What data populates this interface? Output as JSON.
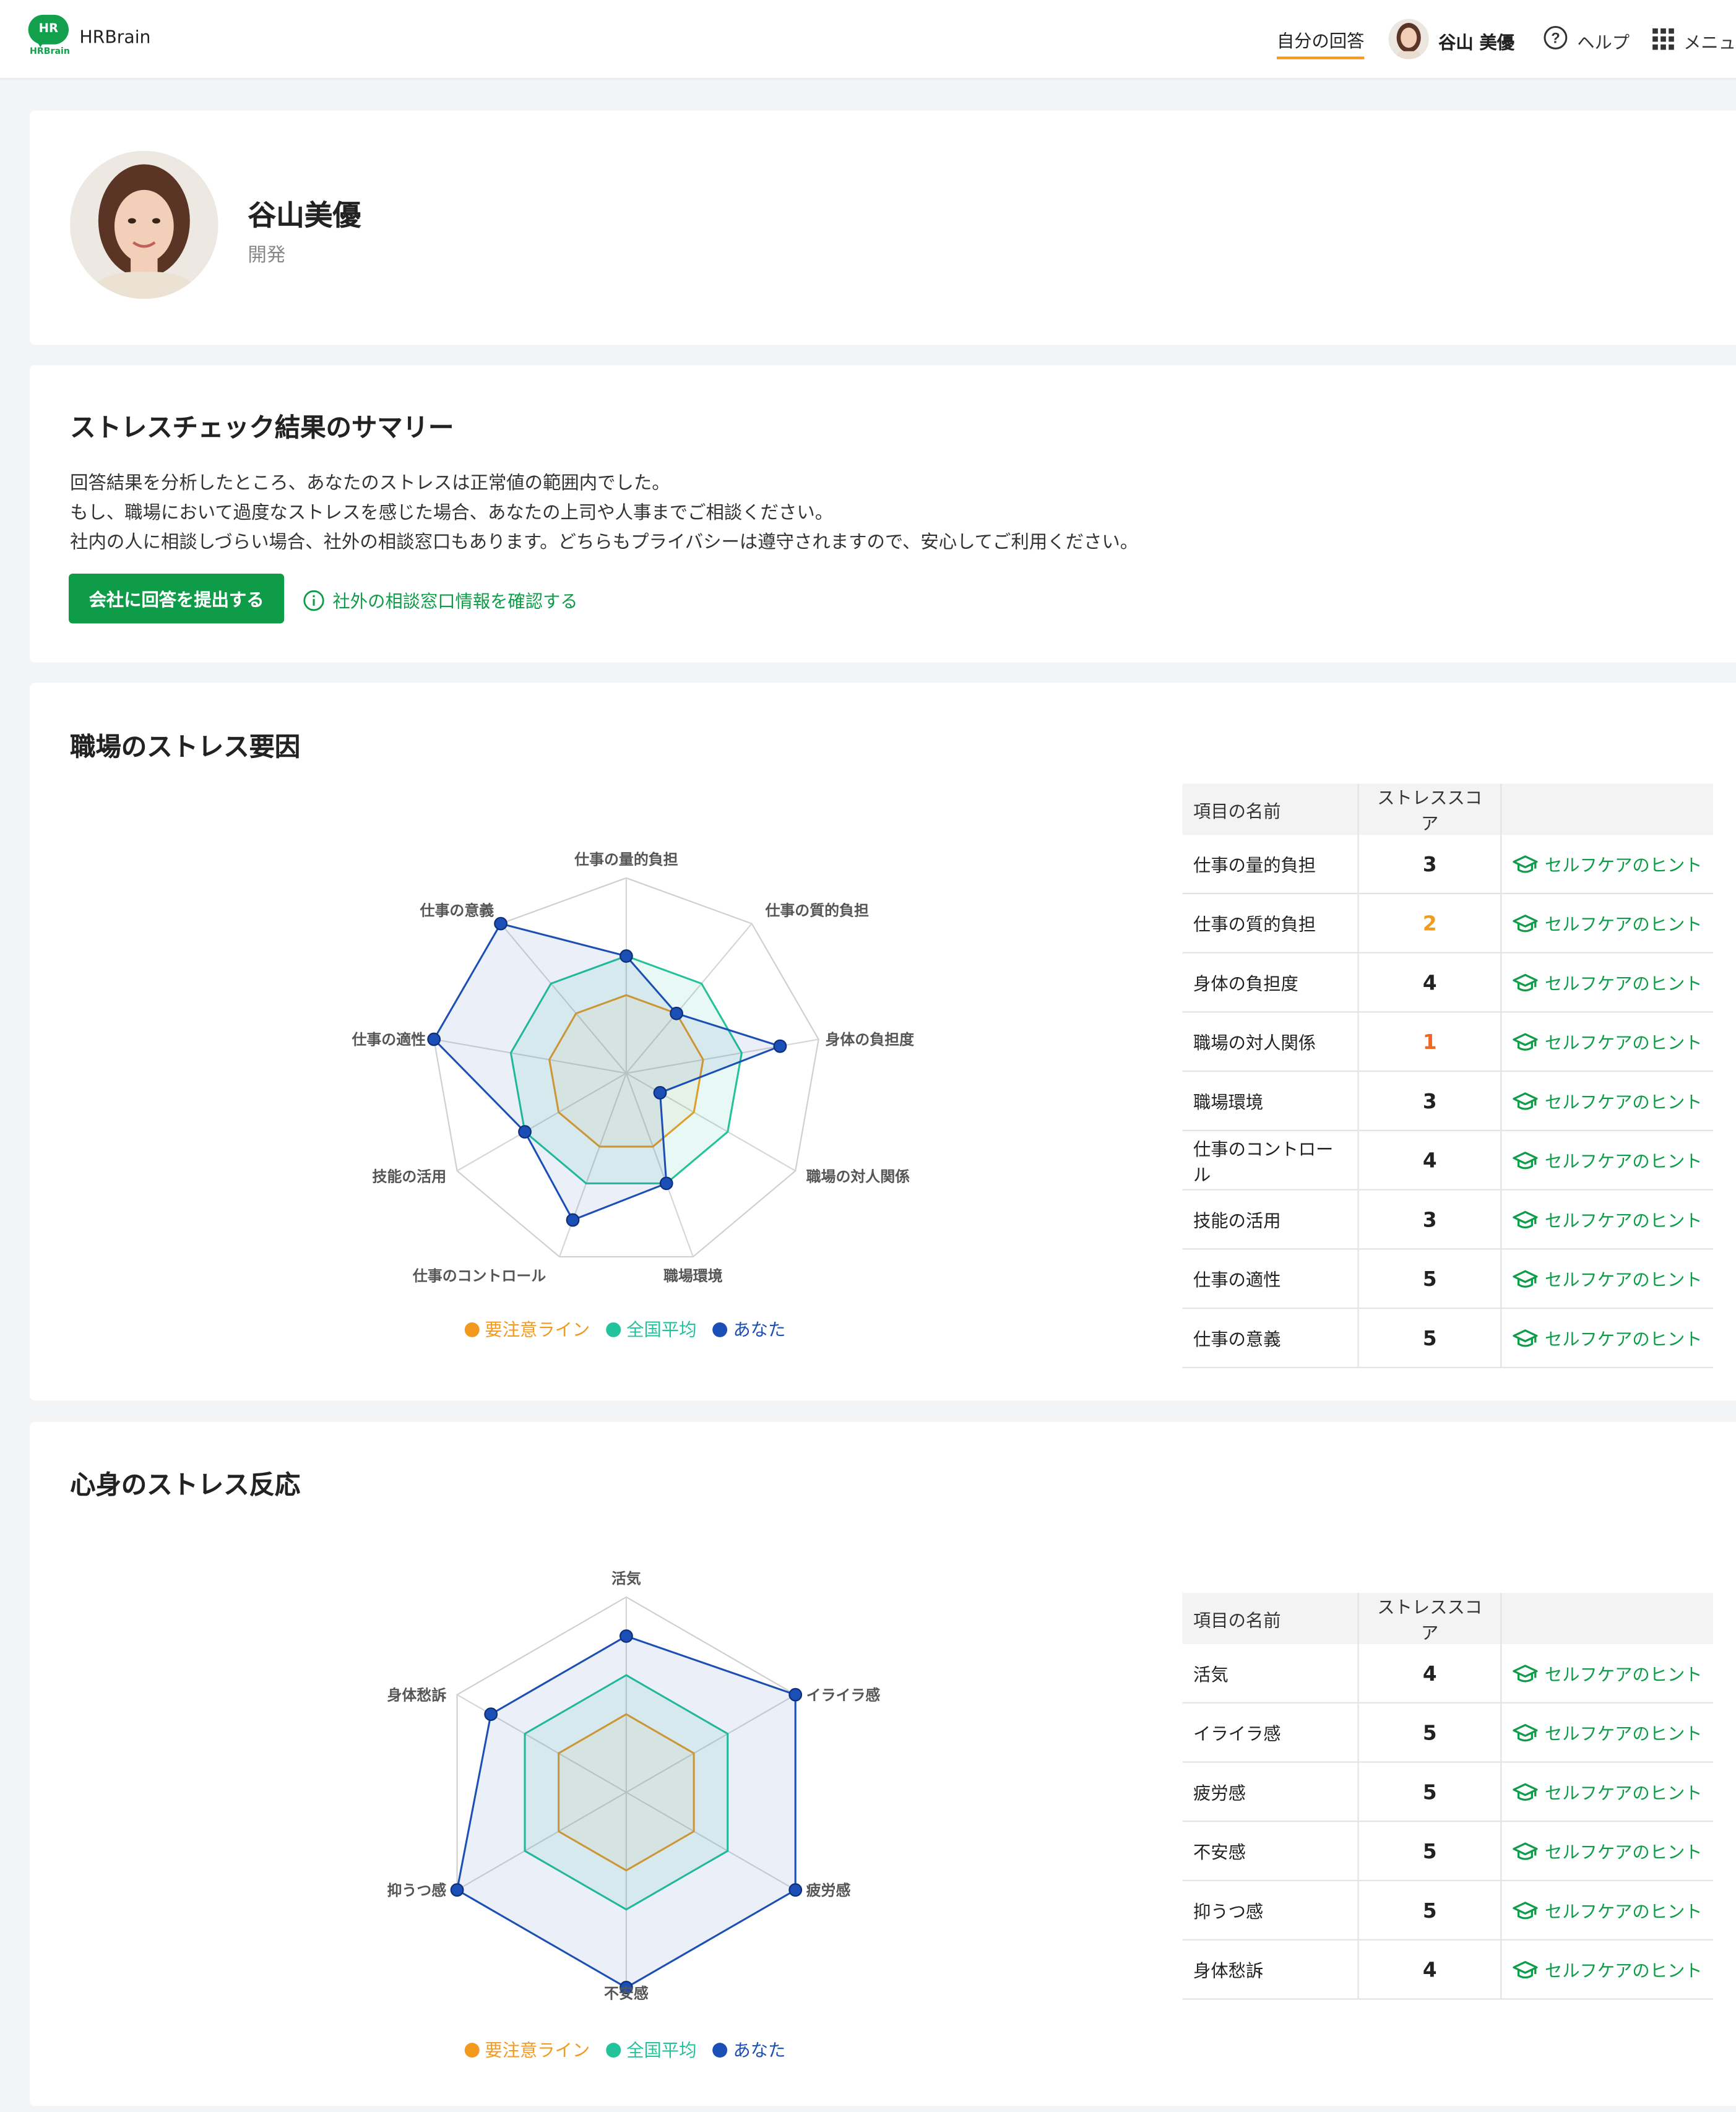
{
  "header": {
    "brand": "HRBrain",
    "logo_text": "HR",
    "logo_sub": "HRBrain",
    "nav_answer": "自分の回答",
    "user_name": "谷山 美優",
    "help": "ヘルプ",
    "menu": "メニュー"
  },
  "profile": {
    "name": "谷山美優",
    "department": "開発"
  },
  "summary": {
    "title": "ストレスチェック結果のサマリー",
    "lines": [
      "回答結果を分析したところ、あなたのストレスは正常値の範囲内でした。",
      "もし、職場において過度なストレスを感じた場合、あなたの上司や人事までご相談ください。",
      "社内の人に相談しづらい場合、社外の相談窓口もあります。どちらもプライバシーは遵守されますので、安心してご利用ください。"
    ],
    "submit_button": "会社に回答を提出する",
    "consult_link": "社外の相談窓口情報を確認する"
  },
  "colors": {
    "caution": "#f39a1e",
    "national": "#22c29a",
    "you": "#1c4fb5",
    "accent": "#0e9c48"
  },
  "legend": {
    "caution": "要注意ライン",
    "national": "全国平均",
    "you": "あなた"
  },
  "table_headers": {
    "name": "項目の名前",
    "score": "ストレススコア"
  },
  "hint_label": "セルフケアのヒント",
  "workplace": {
    "title": "職場のストレス要因",
    "chart_data": {
      "type": "radar",
      "axes": [
        "仕事の量的負担",
        "仕事の質的負担",
        "身体の負担度",
        "職場の対人関係",
        "職場環境",
        "仕事のコントロール",
        "技能の活用",
        "仕事の適性",
        "仕事の意義"
      ],
      "rlim": [
        0,
        5
      ],
      "series": [
        {
          "name": "要注意ライン",
          "values": [
            2,
            2,
            2,
            2,
            2,
            2,
            2,
            2,
            2
          ]
        },
        {
          "name": "全国平均",
          "values": [
            3,
            3,
            3,
            3,
            3,
            3,
            3,
            3,
            3
          ]
        },
        {
          "name": "あなた",
          "values": [
            3,
            2,
            4,
            1,
            3,
            4,
            3,
            5,
            5
          ]
        }
      ]
    },
    "rows": [
      {
        "name": "仕事の量的負担",
        "score": "3",
        "color": "#222222"
      },
      {
        "name": "仕事の質的負担",
        "score": "2",
        "color": "#f39a1e"
      },
      {
        "name": "身体の負担度",
        "score": "4",
        "color": "#222222"
      },
      {
        "name": "職場の対人関係",
        "score": "1",
        "color": "#f26522"
      },
      {
        "name": "職場環境",
        "score": "3",
        "color": "#222222"
      },
      {
        "name": "仕事のコントロール",
        "score": "4",
        "color": "#222222"
      },
      {
        "name": "技能の活用",
        "score": "3",
        "color": "#222222"
      },
      {
        "name": "仕事の適性",
        "score": "5",
        "color": "#222222"
      },
      {
        "name": "仕事の意義",
        "score": "5",
        "color": "#222222"
      }
    ]
  },
  "mindbody": {
    "title": "心身のストレス反応",
    "chart_data": {
      "type": "radar",
      "axes": [
        "活気",
        "イライラ感",
        "疲労感",
        "不安感",
        "抑うつ感",
        "身体愁訴"
      ],
      "rlim": [
        0,
        5
      ],
      "series": [
        {
          "name": "要注意ライン",
          "values": [
            2,
            2,
            2,
            2,
            2,
            2
          ]
        },
        {
          "name": "全国平均",
          "values": [
            3,
            3,
            3,
            3,
            3,
            3
          ]
        },
        {
          "name": "あなた",
          "values": [
            4,
            5,
            5,
            5,
            5,
            4
          ]
        }
      ]
    },
    "rows": [
      {
        "name": "活気",
        "score": "4",
        "color": "#222222"
      },
      {
        "name": "イライラ感",
        "score": "5",
        "color": "#222222"
      },
      {
        "name": "疲労感",
        "score": "5",
        "color": "#222222"
      },
      {
        "name": "不安感",
        "score": "5",
        "color": "#222222"
      },
      {
        "name": "抑うつ感",
        "score": "5",
        "color": "#222222"
      },
      {
        "name": "身体愁訴",
        "score": "4",
        "color": "#222222"
      }
    ]
  }
}
